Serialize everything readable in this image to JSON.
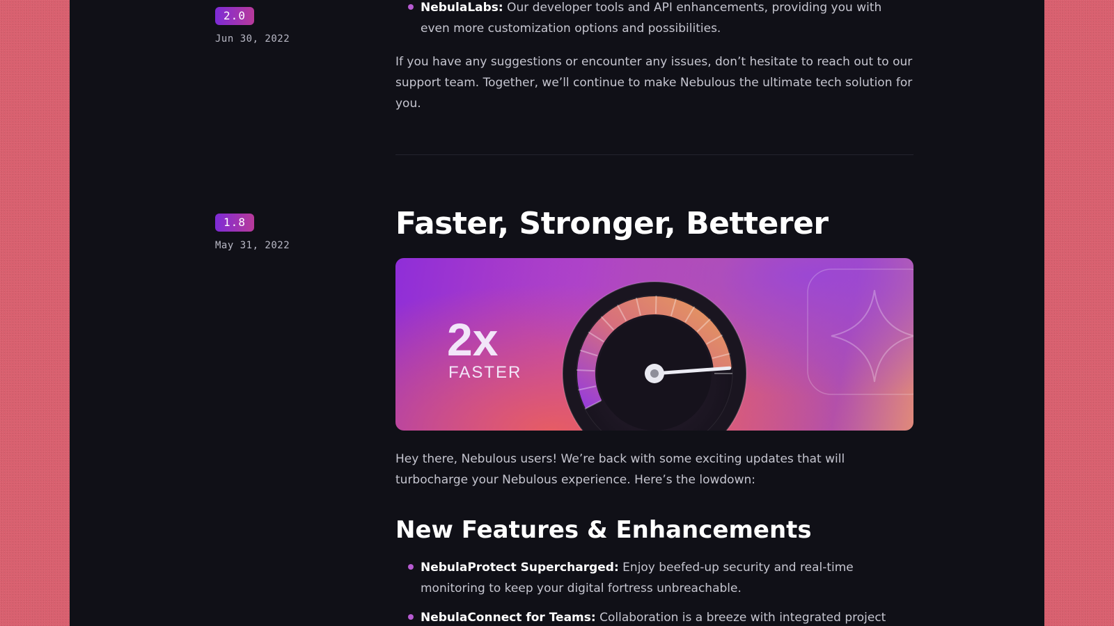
{
  "releases": [
    {
      "version": "2.0",
      "date": "Jun 30, 2022",
      "bullet": {
        "title": "NebulaLabs:",
        "text": "Our developer tools and API enhancements, providing you with even more customization options and possibilities."
      },
      "closing": "If you have any suggestions or encounter any issues, don’t hesitate to reach out to our support team. Together, we’ll continue to make Nebulous the ultimate tech solution for you."
    },
    {
      "version": "1.8",
      "date": "May 31, 2022",
      "title": "Faster, Stronger, Betterer",
      "hero": {
        "big_text": "2x",
        "small_text": "FASTER",
        "gauge_level": 0.98
      },
      "intro": "Hey there, Nebulous users! We’re back with some exciting updates that will turbocharge your Nebulous experience. Here’s the lowdown:",
      "section_title": "New Features & Enhancements",
      "bullets": [
        {
          "title": "NebulaProtect Supercharged:",
          "text": "Enjoy beefed-up security and real-time monitoring to keep your digital fortress unbreachable."
        },
        {
          "title": "NebulaConnect for Teams:",
          "text": "Collaboration is a breeze with integrated project management"
        }
      ]
    }
  ],
  "colors": {
    "page_background": "#d9606f",
    "panel_background": "#101017",
    "badge_gradient_start": "#7d2bd6",
    "badge_gradient_end": "#b83a9a",
    "bullet_dot": "#b75bd1",
    "body_text": "#c6c6d0",
    "heading_text": "#ffffff"
  }
}
